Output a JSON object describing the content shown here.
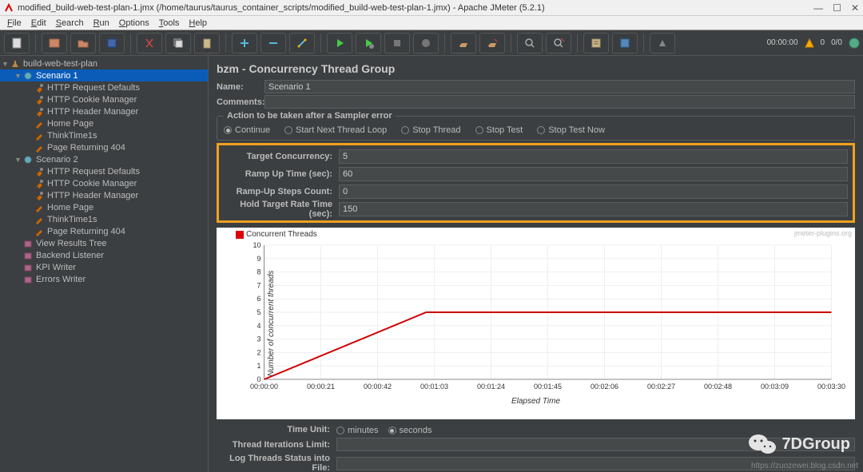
{
  "window": {
    "title": "modified_build-web-test-plan-1.jmx (/home/taurus/taurus_container_scripts/modified_build-web-test-plan-1.jmx) - Apache JMeter (5.2.1)",
    "controls": {
      "min": "—",
      "max": "☐",
      "close": "✕"
    }
  },
  "menu": [
    "File",
    "Edit",
    "Search",
    "Run",
    "Options",
    "Tools",
    "Help"
  ],
  "toolbar_status": {
    "time": "00:00:00",
    "warn": "0",
    "ratio": "0/0"
  },
  "tree": {
    "root": "build-web-test-plan",
    "nodes": [
      {
        "label": "Scenario 1",
        "depth": 1,
        "icon": "gear",
        "toggle": "▼",
        "selected": true
      },
      {
        "label": "HTTP Request Defaults",
        "depth": 2,
        "icon": "wrench"
      },
      {
        "label": "HTTP Cookie Manager",
        "depth": 2,
        "icon": "wrench"
      },
      {
        "label": "HTTP Header Manager",
        "depth": 2,
        "icon": "wrench"
      },
      {
        "label": "Home Page",
        "depth": 2,
        "icon": "pen"
      },
      {
        "label": "ThinkTime1s",
        "depth": 2,
        "icon": "pen"
      },
      {
        "label": "Page Returning 404",
        "depth": 2,
        "icon": "pen"
      },
      {
        "label": "Scenario 2",
        "depth": 1,
        "icon": "gear",
        "toggle": "▼"
      },
      {
        "label": "HTTP Request Defaults",
        "depth": 2,
        "icon": "wrench"
      },
      {
        "label": "HTTP Cookie Manager",
        "depth": 2,
        "icon": "wrench"
      },
      {
        "label": "HTTP Header Manager",
        "depth": 2,
        "icon": "wrench"
      },
      {
        "label": "Home Page",
        "depth": 2,
        "icon": "pen"
      },
      {
        "label": "ThinkTime1s",
        "depth": 2,
        "icon": "pen"
      },
      {
        "label": "Page Returning 404",
        "depth": 2,
        "icon": "pen"
      },
      {
        "label": "View Results Tree",
        "depth": 1,
        "icon": "listener"
      },
      {
        "label": "Backend Listener",
        "depth": 1,
        "icon": "listener"
      },
      {
        "label": "KPI Writer",
        "depth": 1,
        "icon": "listener"
      },
      {
        "label": "Errors Writer",
        "depth": 1,
        "icon": "listener"
      }
    ]
  },
  "panel": {
    "title": "bzm - Concurrency Thread Group",
    "name_label": "Name:",
    "name_value": "Scenario 1",
    "comments_label": "Comments:",
    "comments_value": "",
    "error_legend": "Action to be taken after a Sampler error",
    "error_actions": [
      "Continue",
      "Start Next Thread Loop",
      "Stop Thread",
      "Stop Test",
      "Stop Test Now"
    ],
    "error_selected": "Continue",
    "params": {
      "target_concurrency": {
        "label": "Target Concurrency:",
        "value": "5"
      },
      "ramp_up_time": {
        "label": "Ramp Up Time (sec):",
        "value": "60"
      },
      "ramp_up_steps": {
        "label": "Ramp-Up Steps Count:",
        "value": "0"
      },
      "hold_target": {
        "label": "Hold Target Rate Time (sec):",
        "value": "150"
      }
    },
    "time_unit": {
      "label": "Time Unit:",
      "options": [
        "minutes",
        "seconds"
      ],
      "selected": "seconds"
    },
    "iterations": {
      "label": "Thread Iterations Limit:",
      "value": ""
    },
    "log_file": {
      "label": "Log Threads Status into File:",
      "value": ""
    },
    "chart_watermark": "jmeter-plugins.org"
  },
  "chart_data": {
    "type": "line",
    "title": "",
    "legend": [
      "Concurrent Threads"
    ],
    "xlabel": "Elapsed Time",
    "ylabel": "Number of concurrent threads",
    "x_ticks": [
      "00:00:00",
      "00:00:21",
      "00:00:42",
      "00:01:03",
      "00:01:24",
      "00:01:45",
      "00:02:06",
      "00:02:27",
      "00:02:48",
      "00:03:09",
      "00:03:30"
    ],
    "y_ticks": [
      0,
      1,
      2,
      3,
      4,
      5,
      6,
      7,
      8,
      9,
      10
    ],
    "ylim": [
      0,
      10
    ],
    "xlim_sec": [
      0,
      210
    ],
    "series": [
      {
        "name": "Concurrent Threads",
        "color": "#d00000",
        "points": [
          {
            "x_sec": 0,
            "y": 0
          },
          {
            "x_sec": 60,
            "y": 5
          },
          {
            "x_sec": 210,
            "y": 5
          }
        ]
      }
    ]
  },
  "brand": {
    "name": "7DGroup"
  },
  "footer": {
    "blog": "https://zuozewei.blog.csdn.net"
  }
}
